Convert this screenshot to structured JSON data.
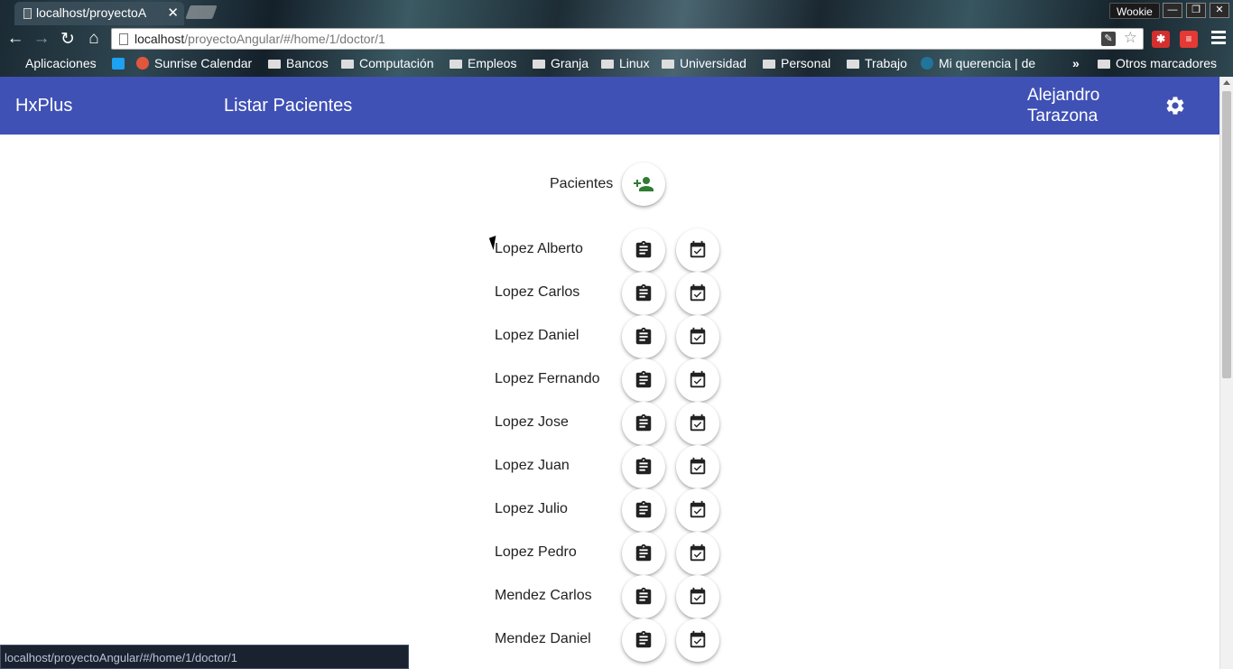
{
  "browser": {
    "tab_title": "localhost/proyectoA",
    "profile_name": "Wookie",
    "url_host": "localhost",
    "url_path": "/proyectoAngular/#/home/1/doctor/1",
    "bookmarks": [
      "Aplicaciones",
      "Sunrise Calendar",
      "Bancos",
      "Computación",
      "Empleos",
      "Granja",
      "Linux",
      "Universidad",
      "Personal",
      "Trabajo",
      "Mi querencia | de"
    ],
    "other_bookmarks": "Otros marcadores",
    "status_url": "localhost/proyectoAngular/#/home/1/doctor/1"
  },
  "header": {
    "brand": "HxPlus",
    "nav_title": "Listar Pacientes",
    "user_name": "Alejandro Tarazona"
  },
  "main": {
    "section_label": "Pacientes",
    "patients": [
      {
        "name": "Lopez Alberto"
      },
      {
        "name": "Lopez Carlos"
      },
      {
        "name": "Lopez Daniel"
      },
      {
        "name": "Lopez Fernando"
      },
      {
        "name": "Lopez Jose"
      },
      {
        "name": "Lopez Juan"
      },
      {
        "name": "Lopez Julio"
      },
      {
        "name": "Lopez Pedro"
      },
      {
        "name": "Mendez Carlos"
      },
      {
        "name": "Mendez Daniel"
      }
    ]
  },
  "colors": {
    "appbar": "#3f51b5",
    "add_icon": "#2e7d32",
    "icon_dark": "#212121"
  },
  "icons": {
    "add": "person-add-icon",
    "history": "clipboard-icon",
    "appointment": "event-available-icon",
    "settings": "gear-icon"
  }
}
